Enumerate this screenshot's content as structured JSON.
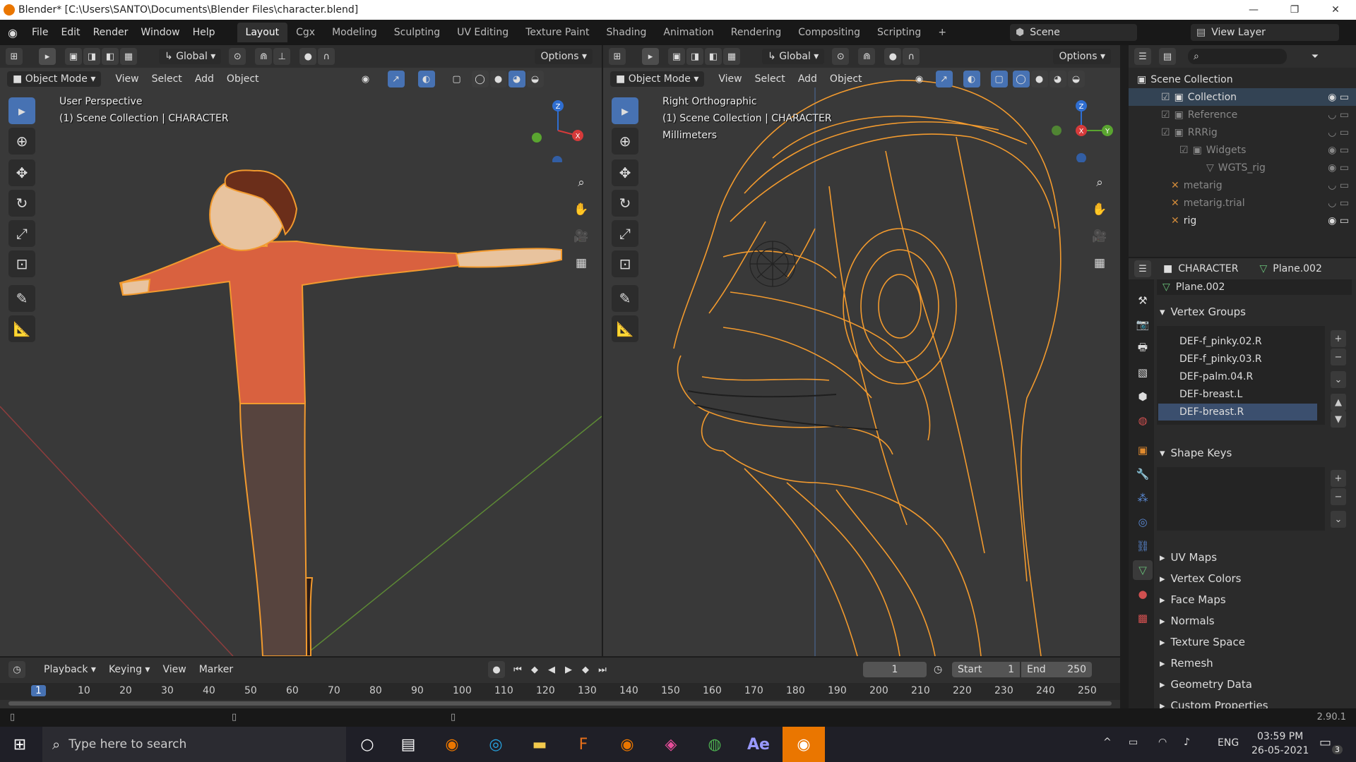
{
  "window": {
    "title": "Blender* [C:\\Users\\SANTO\\Documents\\Blender Files\\character.blend]",
    "minimize": "—",
    "maximize": "❐",
    "close": "✕"
  },
  "menu": {
    "items": [
      "File",
      "Edit",
      "Render",
      "Window",
      "Help"
    ],
    "workspaces": [
      "Layout",
      "Cgx",
      "Modeling",
      "Sculpting",
      "UV Editing",
      "Texture Paint",
      "Shading",
      "Animation",
      "Rendering",
      "Compositing",
      "Scripting"
    ],
    "add_tab": "+",
    "scene": "Scene",
    "view_layer": "View Layer"
  },
  "left_viewport": {
    "transform": "Global",
    "options": "Options",
    "mode": "Object Mode",
    "menus": [
      "View",
      "Select",
      "Add",
      "Object"
    ],
    "perspective": "User Perspective",
    "collection": "(1) Scene Collection | CHARACTER"
  },
  "right_viewport": {
    "transform": "Global",
    "options": "Options",
    "mode": "Object Mode",
    "menus": [
      "View",
      "Select",
      "Add",
      "Object"
    ],
    "perspective": "Right Orthographic",
    "collection": "(1) Scene Collection | CHARACTER",
    "units": "Millimeters"
  },
  "gizmo": {
    "x": "X",
    "y": "Y",
    "z": "Z"
  },
  "outliner": {
    "root": "Scene Collection",
    "rows": [
      "Collection",
      "Reference",
      "RRRig",
      "Widgets",
      "WGTS_rig",
      "metarig",
      "metarig.trial",
      "rig"
    ]
  },
  "properties": {
    "object": "CHARACTER",
    "mesh": "Plane.002",
    "mesh_field": "Plane.002",
    "vertex_groups_title": "Vertex Groups",
    "vertex_groups": [
      "DEF-f_pinky.02.R",
      "DEF-f_pinky.03.R",
      "DEF-palm.04.R",
      "DEF-breast.L",
      "DEF-breast.R"
    ],
    "selected_group": "DEF-breast.R",
    "shape_keys_title": "Shape Keys",
    "sections": [
      "UV Maps",
      "Vertex Colors",
      "Face Maps",
      "Normals",
      "Texture Space",
      "Remesh",
      "Geometry Data",
      "Custom Properties"
    ]
  },
  "timeline": {
    "menus": [
      "Playback",
      "Keying",
      "View",
      "Marker"
    ],
    "current_frame": "1",
    "start_label": "Start",
    "start": "1",
    "end_label": "End",
    "end": "250",
    "ruler": [
      "1",
      "10",
      "20",
      "30",
      "40",
      "50",
      "60",
      "70",
      "80",
      "90",
      "100",
      "110",
      "120",
      "130",
      "140",
      "150",
      "160",
      "170",
      "180",
      "190",
      "200",
      "210",
      "220",
      "230",
      "240",
      "250"
    ]
  },
  "status": {
    "version": "2.90.1"
  },
  "taskbar": {
    "search_placeholder": "Type here to search",
    "language": "ENG",
    "time": "03:59 PM",
    "date": "26-05-2021",
    "notifications": "3"
  },
  "colors": {
    "accent": "#4772b3",
    "selection": "#f29a2e",
    "shirt": "#d9613f",
    "skin": "#e8c39e",
    "pants": "#57443e",
    "hair": "#6b2e1a"
  }
}
